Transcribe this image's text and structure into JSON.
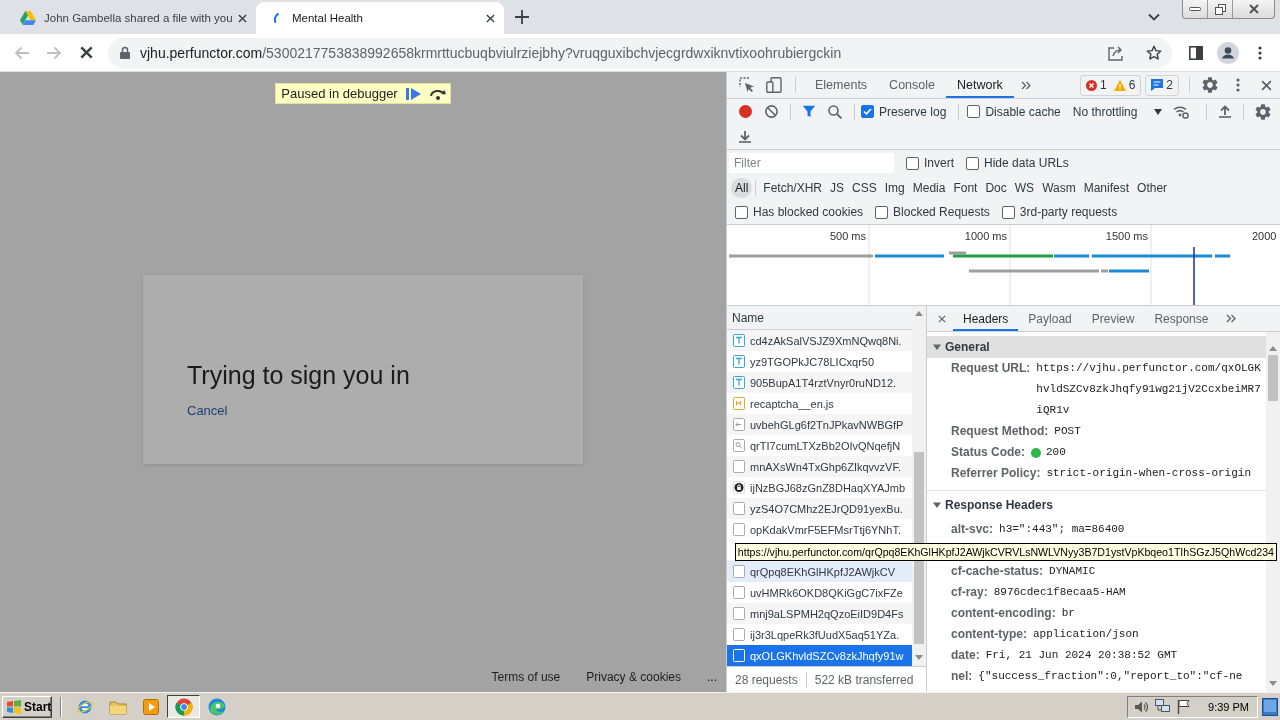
{
  "browser": {
    "tabs": [
      {
        "title": "John Gambella shared a file with you",
        "selected": false,
        "loading": false
      },
      {
        "title": "Mental Health",
        "selected": true,
        "loading": true
      }
    ],
    "back": {
      "disabled": true
    },
    "forward": {
      "disabled": true
    },
    "loading": true,
    "address": {
      "domain": "vjhu.perfunctor.com",
      "path": "/5300217753838992658krmrttucbuqbviulrziejbhy?vruqguxibchvjecgrdwxiknvtixoohrubiergckin"
    }
  },
  "page": {
    "debugger_banner": "Paused in debugger",
    "dialog": {
      "title": "Trying to sign you in",
      "link": "Cancel"
    },
    "footer_links": [
      "Terms of use",
      "Privacy & cookies",
      "..."
    ]
  },
  "devtools": {
    "panels": [
      {
        "label": "Elements",
        "selected": false
      },
      {
        "label": "Console",
        "selected": false
      },
      {
        "label": "Network",
        "selected": true
      }
    ],
    "issues": {
      "errors": "1",
      "warnings": "6",
      "messages": "2"
    },
    "network": {
      "recording": true,
      "preserve_log": {
        "label": "Preserve log",
        "checked": true
      },
      "disable_cache": {
        "label": "Disable cache",
        "checked": false
      },
      "throttling": "No throttling",
      "filter": {
        "placeholder": "Filter"
      },
      "filter_options": [
        {
          "label": "Invert",
          "checked": false
        },
        {
          "label": "Hide data URLs",
          "checked": false
        }
      ],
      "types": [
        {
          "label": "All",
          "selected": true
        },
        {
          "label": "Fetch/XHR",
          "selected": false
        },
        {
          "label": "JS",
          "selected": false
        },
        {
          "label": "CSS",
          "selected": false
        },
        {
          "label": "Img",
          "selected": false
        },
        {
          "label": "Media",
          "selected": false
        },
        {
          "label": "Font",
          "selected": false
        },
        {
          "label": "Doc",
          "selected": false
        },
        {
          "label": "WS",
          "selected": false
        },
        {
          "label": "Wasm",
          "selected": false
        },
        {
          "label": "Manifest",
          "selected": false
        },
        {
          "label": "Other",
          "selected": false
        }
      ],
      "request_filters": [
        {
          "label": "Has blocked cookies",
          "checked": false
        },
        {
          "label": "Blocked Requests",
          "checked": false
        },
        {
          "label": "3rd-party requests",
          "checked": false
        }
      ],
      "overview": {
        "ticks": [
          "500 ms",
          "1000 ms",
          "1500 ms",
          "2000"
        ]
      },
      "requests": {
        "column": "Name",
        "rows": [
          {
            "name": "cd4zAkSalVSJZ9XmNQwq8Ni.",
            "kind": "text",
            "selected": false,
            "hovered": false
          },
          {
            "name": "yz9TGOPkJC78LICxqr50",
            "kind": "text",
            "selected": false,
            "hovered": false
          },
          {
            "name": "905BupA1T4rztVnyr0ruND12.",
            "kind": "text",
            "selected": false,
            "hovered": false
          },
          {
            "name": "recaptcha__en.js",
            "kind": "script",
            "selected": false,
            "hovered": false
          },
          {
            "name": "uvbehGLg6f2TnJPkavNWBGfP",
            "kind": "ping",
            "selected": false,
            "hovered": false
          },
          {
            "name": "qrTI7cumLTXzBb2OIvQNqefjN",
            "kind": "image",
            "selected": false,
            "hovered": false
          },
          {
            "name": "mnAXsWn4TxGhp6ZIkqvvzVF.",
            "kind": "other",
            "selected": false,
            "hovered": false
          },
          {
            "name": "ijNzBGJ68zGnZ8DHaqXYAJmb",
            "kind": "font",
            "selected": false,
            "hovered": false
          },
          {
            "name": "yzS4O7CMhz2EJrQD91yexBu.",
            "kind": "other",
            "selected": false,
            "hovered": false
          },
          {
            "name": "opKdakVmrF5EFMsrTtj6YNhT.",
            "kind": "other",
            "selected": false,
            "hovered": false
          },
          {
            "name": "qrQpq8EKhGlHKpfJ2AWjkCV",
            "kind": "other",
            "selected": false,
            "hovered": true
          },
          {
            "name": "uvHMRk6OKD8QKiGgC7ixFZe",
            "kind": "other",
            "selected": false,
            "hovered": false
          },
          {
            "name": "mnj9aLSPMH2qQzoEiID9D4Fs",
            "kind": "other",
            "selected": false,
            "hovered": false
          },
          {
            "name": "ij3r3LqpeRk3fUudX5aq51YZa.",
            "kind": "other",
            "selected": false,
            "hovered": false
          },
          {
            "name": "qxOLGKhvldSZCv8zkJhqfy91w",
            "kind": "other",
            "selected": true,
            "hovered": false
          }
        ],
        "summary": [
          "28 requests",
          "522 kB transferred"
        ]
      },
      "details": {
        "tabs": [
          {
            "label": "Headers",
            "selected": true
          },
          {
            "label": "Payload",
            "selected": false
          },
          {
            "label": "Preview",
            "selected": false
          },
          {
            "label": "Response",
            "selected": false
          }
        ],
        "sections": [
          {
            "title": "General",
            "expanded": true,
            "focused": true,
            "rows": [
              {
                "kind": "text",
                "name": "Request URL:",
                "value": "https://vjhu.perfunctor.com/qxOLGKhvldSZCv8zkJhqfy91wg21jV2CcxbeiMR7iQR1v"
              },
              {
                "kind": "text",
                "name": "Request Method:",
                "value": "POST"
              },
              {
                "kind": "status",
                "name": "Status Code:",
                "value": "200"
              },
              {
                "kind": "text",
                "name": "Referrer Policy:",
                "value": "strict-origin-when-cross-origin"
              }
            ]
          },
          {
            "title": "Response Headers",
            "expanded": true,
            "focused": false,
            "rows": [
              {
                "kind": "text",
                "name": "alt-svc:",
                "value": "h3=\":443\"; ma=86400"
              },
              {
                "kind": "text",
                "name": "cf-cache-status:",
                "value": "DYNAMIC"
              },
              {
                "kind": "text",
                "name": "cf-ray:",
                "value": "8976cdec1f8ecaa5-HAM"
              },
              {
                "kind": "text",
                "name": "content-encoding:",
                "value": "br"
              },
              {
                "kind": "text",
                "name": "content-type:",
                "value": "application/json"
              },
              {
                "kind": "text",
                "name": "date:",
                "value": "Fri, 21 Jun 2024 20:38:52 GMT"
              },
              {
                "kind": "text",
                "name": "nel:",
                "value": "{\"success_fraction\":0,\"report_to\":\"cf-ne"
              }
            ]
          }
        ]
      },
      "tooltip": "https://vjhu.perfunctor.com/qrQpq8EKhGlHKpfJ2AWjkCVRVLsNWLVNyy3B7D1ystVpKbqeo1TIhSGzJ5QhWcd234"
    }
  },
  "taskbar": {
    "start": "Start",
    "apps": [
      {
        "kind": "ie",
        "selected": false
      },
      {
        "kind": "folder",
        "selected": false
      },
      {
        "kind": "media",
        "selected": false
      },
      {
        "kind": "chrome",
        "selected": true
      },
      {
        "kind": "edge",
        "selected": false
      }
    ],
    "clock": "9:39 PM"
  }
}
